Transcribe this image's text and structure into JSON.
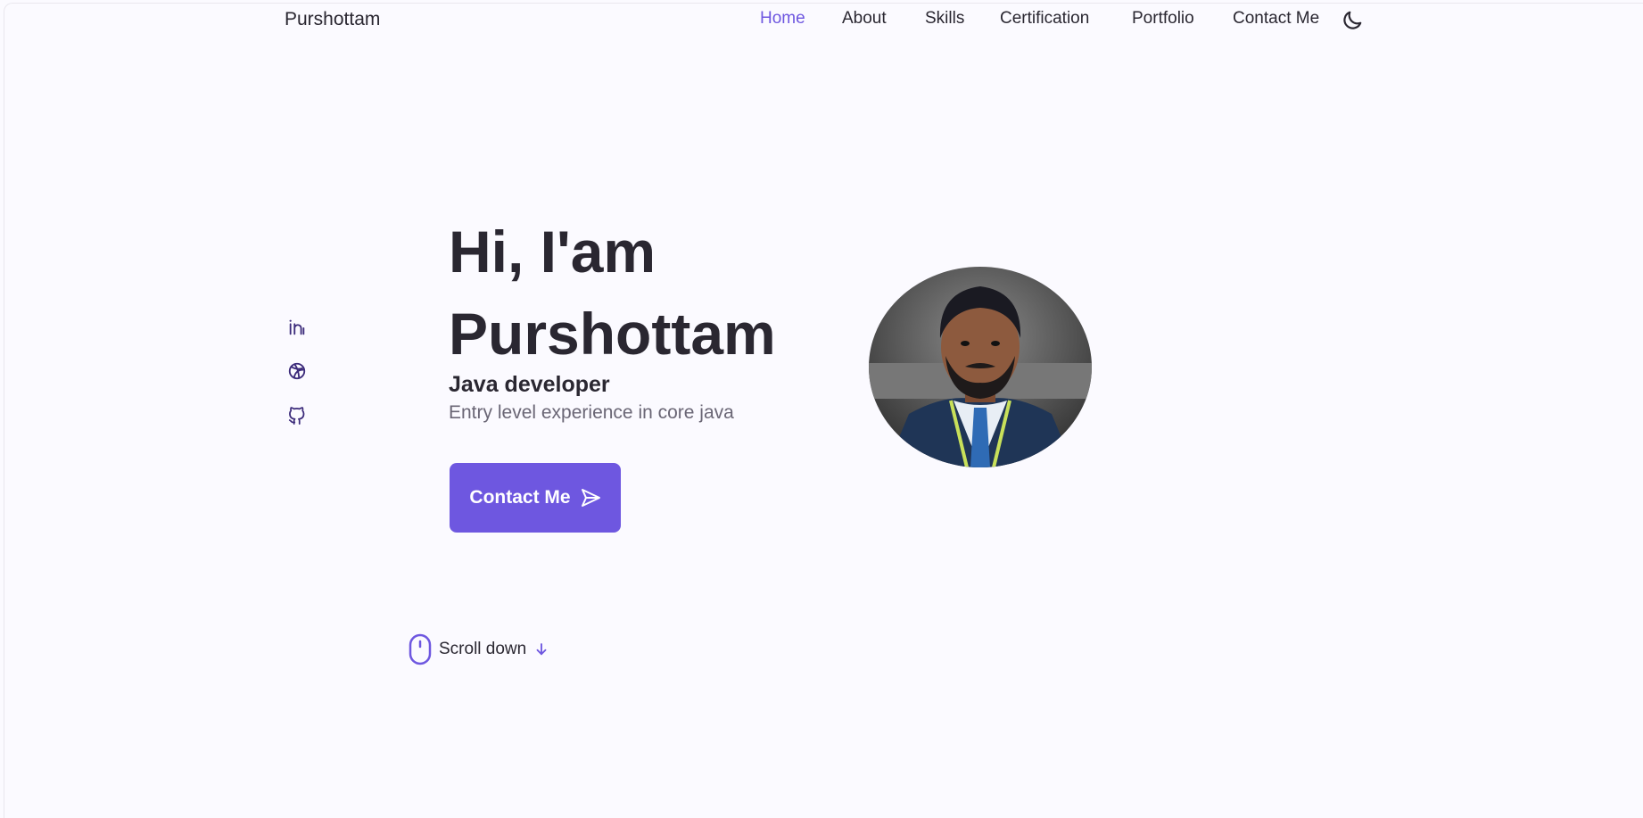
{
  "header": {
    "logo": "Purshottam",
    "nav": [
      "Home",
      "About",
      "Skills",
      "Certification",
      "Portfolio",
      "Contact Me"
    ],
    "active_nav": "Home",
    "theme_toggle_icon": "moon-icon"
  },
  "social": {
    "icons": [
      "linkedin-icon",
      "dribbble-icon",
      "github-icon"
    ]
  },
  "hero": {
    "greeting_line1": "Hi, I'am",
    "greeting_line2": "Purshottam",
    "role": "Java developer",
    "description": "Entry level experience in core java",
    "cta_label": "Contact Me",
    "cta_icon": "send-icon"
  },
  "scroll": {
    "label": "Scroll down",
    "mouse_icon": "mouse-icon",
    "arrow_icon": "arrow-down-icon"
  },
  "colors": {
    "accent": "#6e57e0",
    "background": "#fbfaff",
    "text": "#2a2731"
  }
}
